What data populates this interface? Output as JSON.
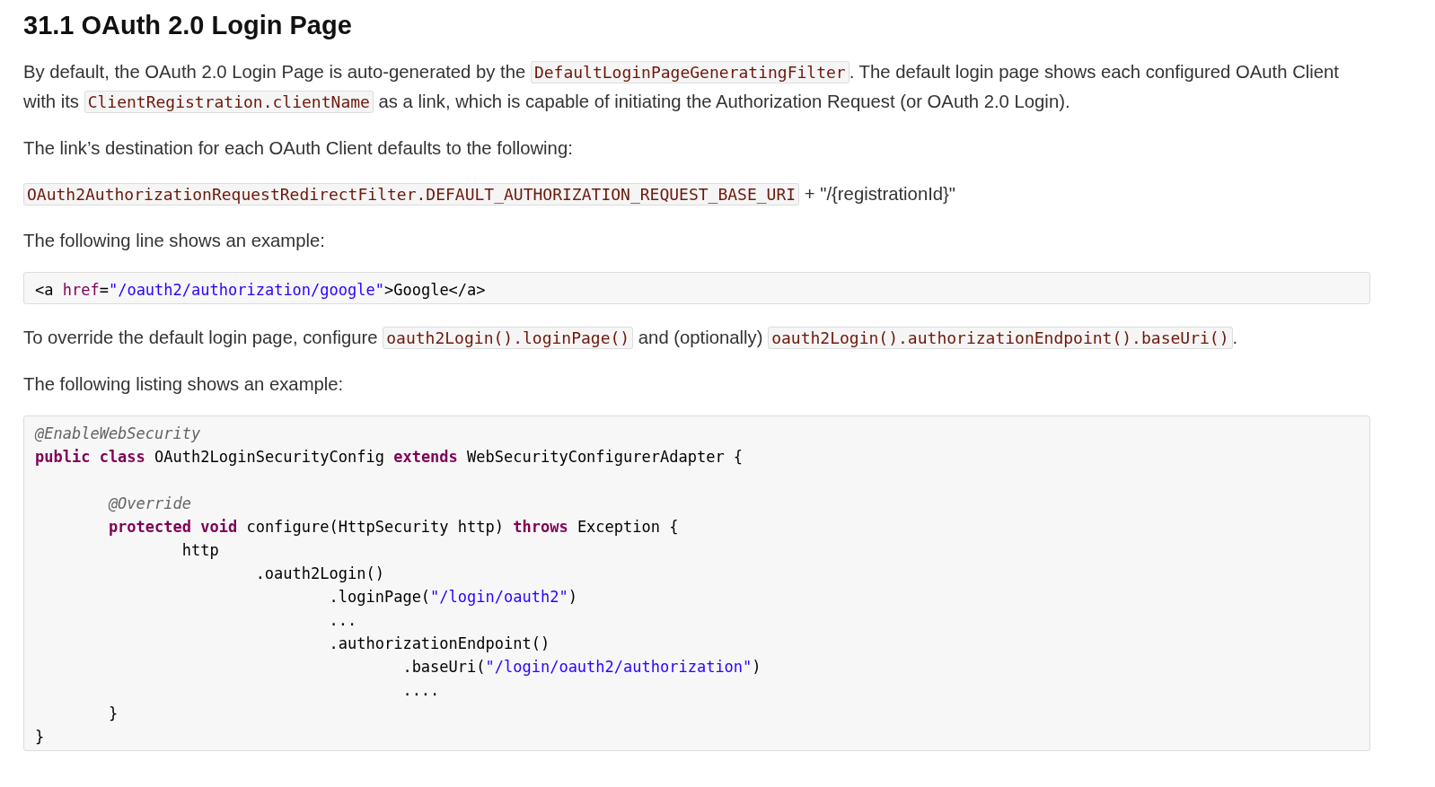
{
  "heading": "31.1 OAuth 2.0 Login Page",
  "blocks": [
    {
      "kind": "para",
      "segments": [
        {
          "kind": "text",
          "text": "By default, the OAuth 2.0 Login Page is auto-generated by the "
        },
        {
          "kind": "code",
          "text": "DefaultLoginPageGeneratingFilter"
        },
        {
          "kind": "text",
          "text": ". The default login page shows each configured OAuth Client with its "
        },
        {
          "kind": "code",
          "text": "ClientRegistration.clientName"
        },
        {
          "kind": "text",
          "text": " as a link, which is capable of initiating the Authorization Request (or OAuth 2.0 Login)."
        }
      ]
    },
    {
      "kind": "para",
      "segments": [
        {
          "kind": "text",
          "text": "The link’s destination for each OAuth Client defaults to the following:"
        }
      ]
    },
    {
      "kind": "para",
      "segments": [
        {
          "kind": "code",
          "text": "OAuth2AuthorizationRequestRedirectFilter.DEFAULT_AUTHORIZATION_REQUEST_BASE_URI"
        },
        {
          "kind": "text",
          "text": " + \"/{registrationId}\""
        }
      ]
    },
    {
      "kind": "para",
      "segments": [
        {
          "kind": "text",
          "text": "The following line shows an example:"
        }
      ]
    },
    {
      "kind": "listing",
      "lines": [
        {
          "kind": "code",
          "tokens": [
            {
              "kind": "plain",
              "text": "<a "
            },
            {
              "kind": "attr",
              "text": "href"
            },
            {
              "kind": "plain",
              "text": "="
            },
            {
              "kind": "string",
              "text": "\"/oauth2/authorization/google\""
            },
            {
              "kind": "plain",
              "text": ">Google</a>"
            }
          ]
        }
      ]
    },
    {
      "kind": "para",
      "segments": [
        {
          "kind": "text",
          "text": "To override the default login page, configure "
        },
        {
          "kind": "code",
          "text": "oauth2Login().loginPage()"
        },
        {
          "kind": "text",
          "text": " and (optionally) "
        },
        {
          "kind": "code",
          "text": "oauth2Login().authorizationEndpoint().baseUri()"
        },
        {
          "kind": "text",
          "text": "."
        }
      ]
    },
    {
      "kind": "para",
      "segments": [
        {
          "kind": "text",
          "text": "The following listing shows an example:"
        }
      ]
    },
    {
      "kind": "listing",
      "lines": [
        {
          "kind": "code",
          "tokens": [
            {
              "kind": "annotation",
              "text": "@EnableWebSecurity"
            }
          ]
        },
        {
          "kind": "code",
          "tokens": [
            {
              "kind": "keyword",
              "text": "public class"
            },
            {
              "kind": "plain",
              "text": " OAuth2LoginSecurityConfig "
            },
            {
              "kind": "keyword",
              "text": "extends"
            },
            {
              "kind": "plain",
              "text": " WebSecurityConfigurerAdapter {"
            }
          ]
        },
        {
          "kind": "blank"
        },
        {
          "kind": "code",
          "tokens": [
            {
              "kind": "annotation",
              "text": "        @Override"
            }
          ]
        },
        {
          "kind": "code",
          "tokens": [
            {
              "kind": "keyword",
              "text": "        protected void"
            },
            {
              "kind": "plain",
              "text": " configure(HttpSecurity http) "
            },
            {
              "kind": "keyword",
              "text": "throws"
            },
            {
              "kind": "plain",
              "text": " Exception {"
            }
          ]
        },
        {
          "kind": "code",
          "tokens": [
            {
              "kind": "plain",
              "text": "                http"
            }
          ]
        },
        {
          "kind": "code",
          "tokens": [
            {
              "kind": "plain",
              "text": "                        .oauth2Login()"
            }
          ]
        },
        {
          "kind": "code",
          "tokens": [
            {
              "kind": "plain",
              "text": "                                .loginPage("
            },
            {
              "kind": "string",
              "text": "\"/login/oauth2\""
            },
            {
              "kind": "plain",
              "text": ")"
            }
          ]
        },
        {
          "kind": "code",
          "tokens": [
            {
              "kind": "plain",
              "text": "                                ..."
            }
          ]
        },
        {
          "kind": "code",
          "tokens": [
            {
              "kind": "plain",
              "text": "                                .authorizationEndpoint()"
            }
          ]
        },
        {
          "kind": "code",
          "tokens": [
            {
              "kind": "plain",
              "text": "                                        .baseUri("
            },
            {
              "kind": "string",
              "text": "\"/login/oauth2/authorization\""
            },
            {
              "kind": "plain",
              "text": ")"
            }
          ]
        },
        {
          "kind": "code",
          "tokens": [
            {
              "kind": "plain",
              "text": "                                        ...."
            }
          ]
        },
        {
          "kind": "code",
          "tokens": [
            {
              "kind": "plain",
              "text": "        }"
            }
          ]
        },
        {
          "kind": "code",
          "tokens": [
            {
              "kind": "plain",
              "text": "}"
            }
          ]
        }
      ]
    }
  ]
}
